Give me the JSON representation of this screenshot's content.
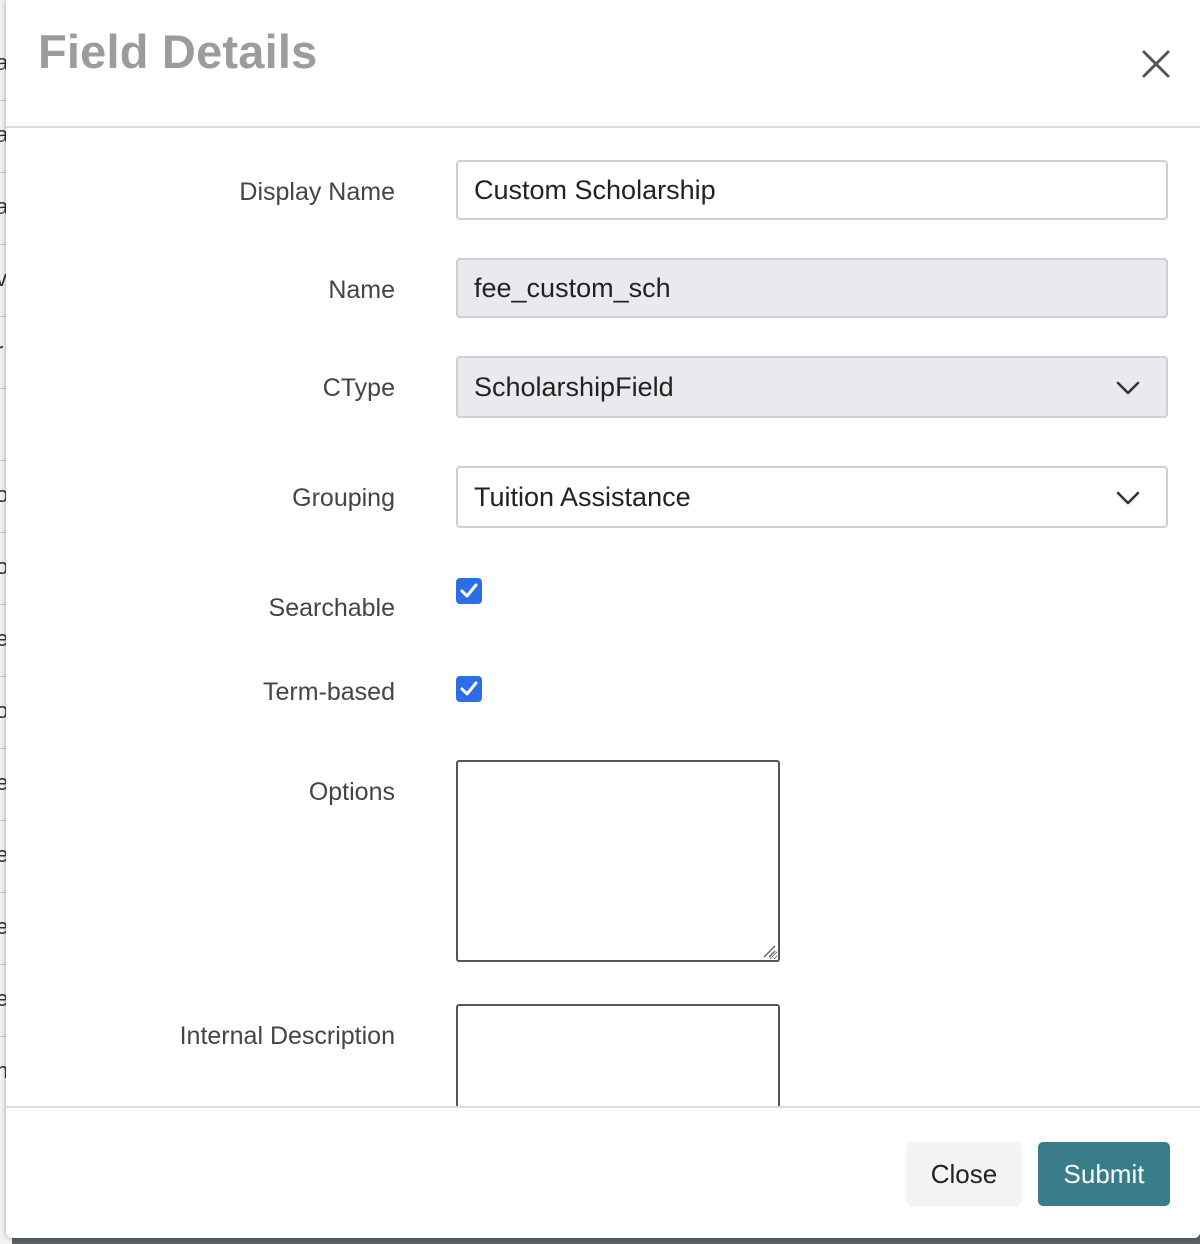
{
  "background": {
    "glyphs": [
      "a",
      "a",
      "a",
      "vi",
      "r",
      "i",
      "o",
      "o",
      "e",
      "o",
      "e",
      "e",
      "e",
      "e",
      "n"
    ]
  },
  "modal": {
    "title": "Field Details",
    "close_icon": "close-icon"
  },
  "form": {
    "display_name": {
      "label": "Display Name",
      "value": "Custom Scholarship"
    },
    "name": {
      "label": "Name",
      "value": "fee_custom_sch"
    },
    "ctype": {
      "label": "CType",
      "value": "ScholarshipField"
    },
    "grouping": {
      "label": "Grouping",
      "value": "Tuition Assistance"
    },
    "searchable": {
      "label": "Searchable",
      "checked": true
    },
    "term_based": {
      "label": "Term-based",
      "checked": true
    },
    "options": {
      "label": "Options",
      "value": ""
    },
    "internal_description": {
      "label": "Internal Description",
      "value": ""
    }
  },
  "footer": {
    "close_label": "Close",
    "submit_label": "Submit"
  },
  "colors": {
    "accent": "#3a7d8a",
    "checkbox": "#2b6ee8",
    "readonly_bg": "#e9eaed",
    "title": "#9c9c9c"
  }
}
